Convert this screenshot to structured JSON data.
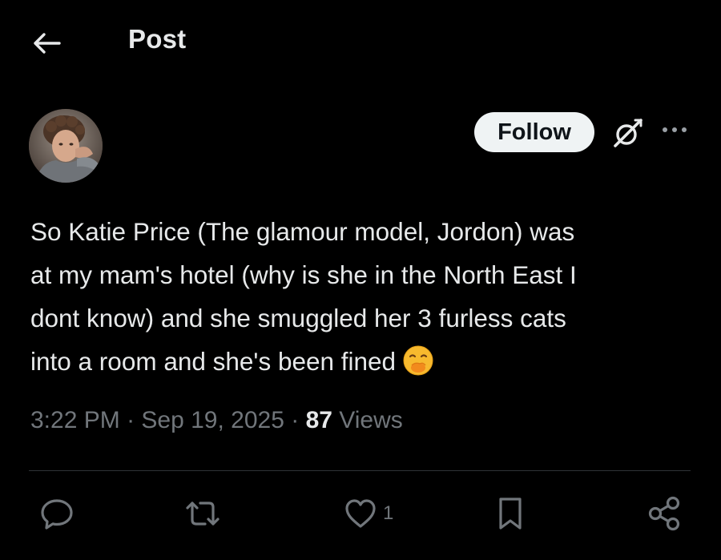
{
  "header": {
    "title": "Post"
  },
  "author": {
    "follow_label": "Follow"
  },
  "post": {
    "lines": [
      "So Katie Price (The glamour model, Jordon) was",
      "at my mam's hotel (why is she in the North East I",
      "dont know) and she smuggled her 3 furless cats",
      "into a room and she's been fined"
    ],
    "time": "3:22 PM",
    "separator": " · ",
    "date": "Sep 19, 2025",
    "views_count": "87",
    "views_label": "Views"
  },
  "actions": {
    "like_count": "1"
  },
  "colors": {
    "background": "#000000",
    "text": "#e7e9ea",
    "muted": "#71767b",
    "divider": "#2f3336",
    "follow_bg": "#eff3f4"
  },
  "icons": [
    "back-arrow-icon",
    "grok-icon",
    "more-icon",
    "reply-icon",
    "repost-icon",
    "like-icon",
    "bookmark-icon",
    "share-icon",
    "face-with-hand-over-mouth-emoji"
  ]
}
